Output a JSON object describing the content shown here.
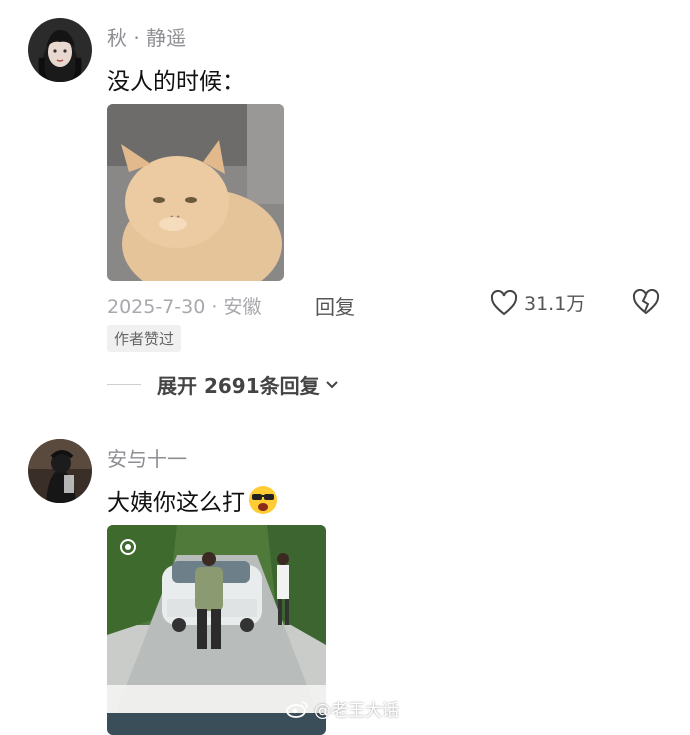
{
  "comments": [
    {
      "username": "秋 · 静遥",
      "text": "没人的时候：",
      "date_location": "2025-7-30 · 安徽",
      "reply_label": "回复",
      "like_count": "31.1万",
      "author_badge": "作者赞过",
      "expand_label": "展开 2691条回复",
      "image_icon": "cat-photo"
    },
    {
      "username": "安与十一",
      "text": "大姨你这么打",
      "emoji": "😎",
      "image_icon": "street-video-thumbnail"
    }
  ],
  "watermark": {
    "text": "@老王大话",
    "icon": "weibo-icon"
  },
  "icons": {
    "like": "heart-icon",
    "dislike": "broken-heart-icon",
    "expand": "chevron-down-icon"
  }
}
